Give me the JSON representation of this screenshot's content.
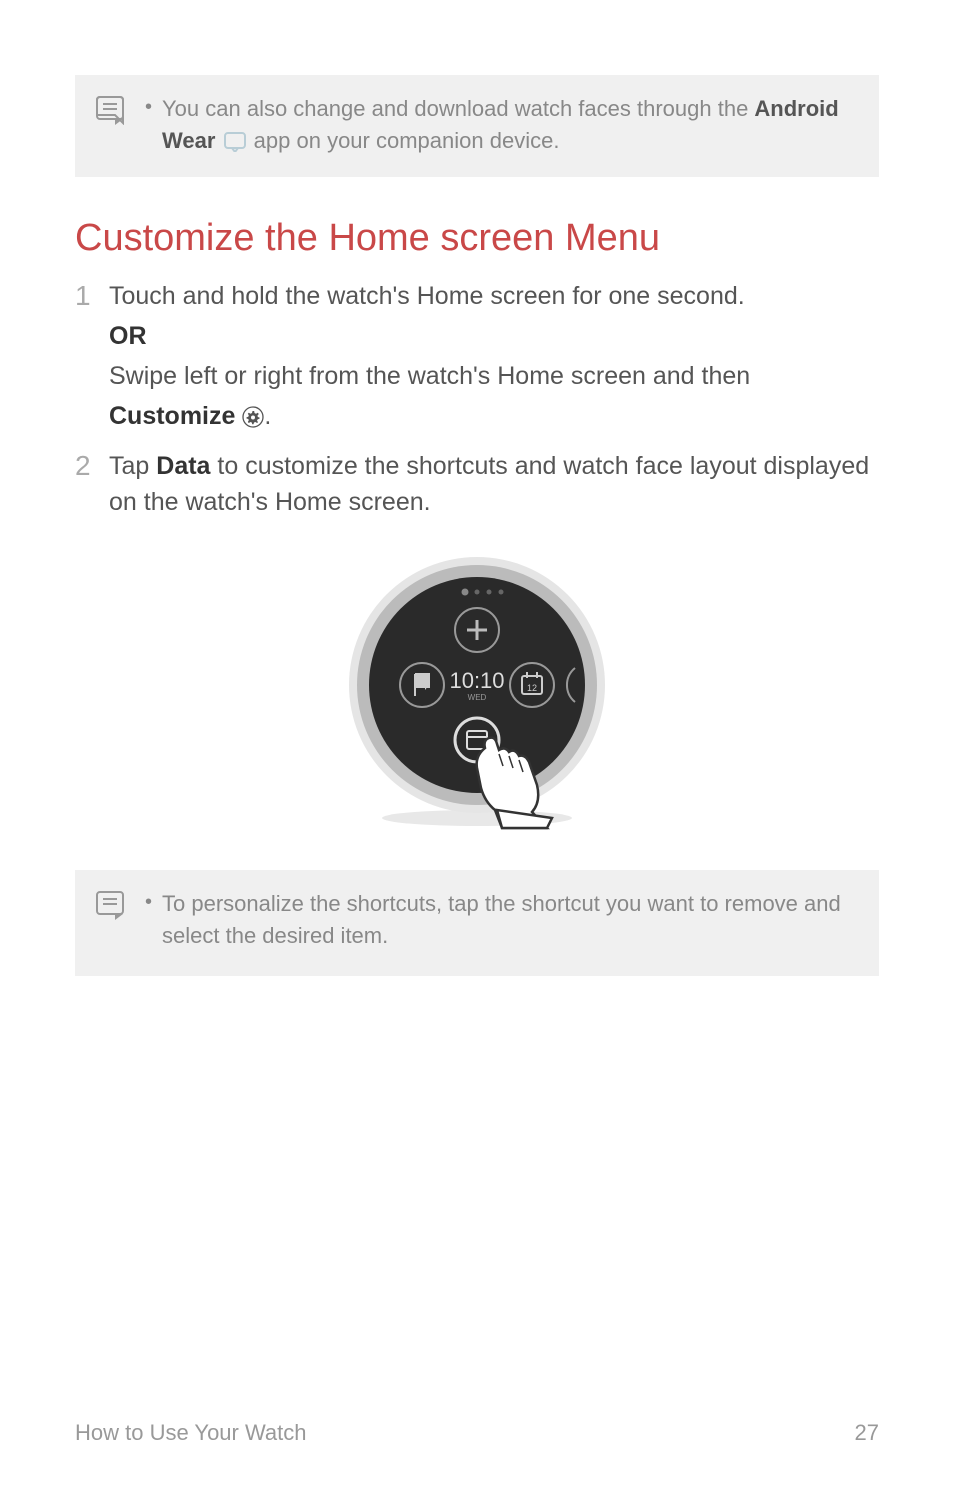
{
  "note1": {
    "text_before": "You can also change and download watch faces through the ",
    "bold1": "Android Wear",
    "text_after": " app on your companion device."
  },
  "heading": "Customize the Home screen Menu",
  "step1": {
    "number": "1",
    "line1": "Touch and hold the watch's Home screen for one second.",
    "or": "OR",
    "line2": "Swipe left or right from the watch's Home screen and then",
    "customize": "Customize",
    "period": "."
  },
  "step2": {
    "number": "2",
    "text_before": "Tap ",
    "bold": "Data",
    "text_after": " to customize the shortcuts and watch face layout displayed on the watch's Home screen."
  },
  "watch": {
    "time": "10:10",
    "day": "WED",
    "cal_num": "12"
  },
  "note2": {
    "text": "To personalize the shortcuts, tap the shortcut you want to remove and select the desired item."
  },
  "footer": {
    "section": "How to Use Your Watch",
    "page": "27"
  }
}
